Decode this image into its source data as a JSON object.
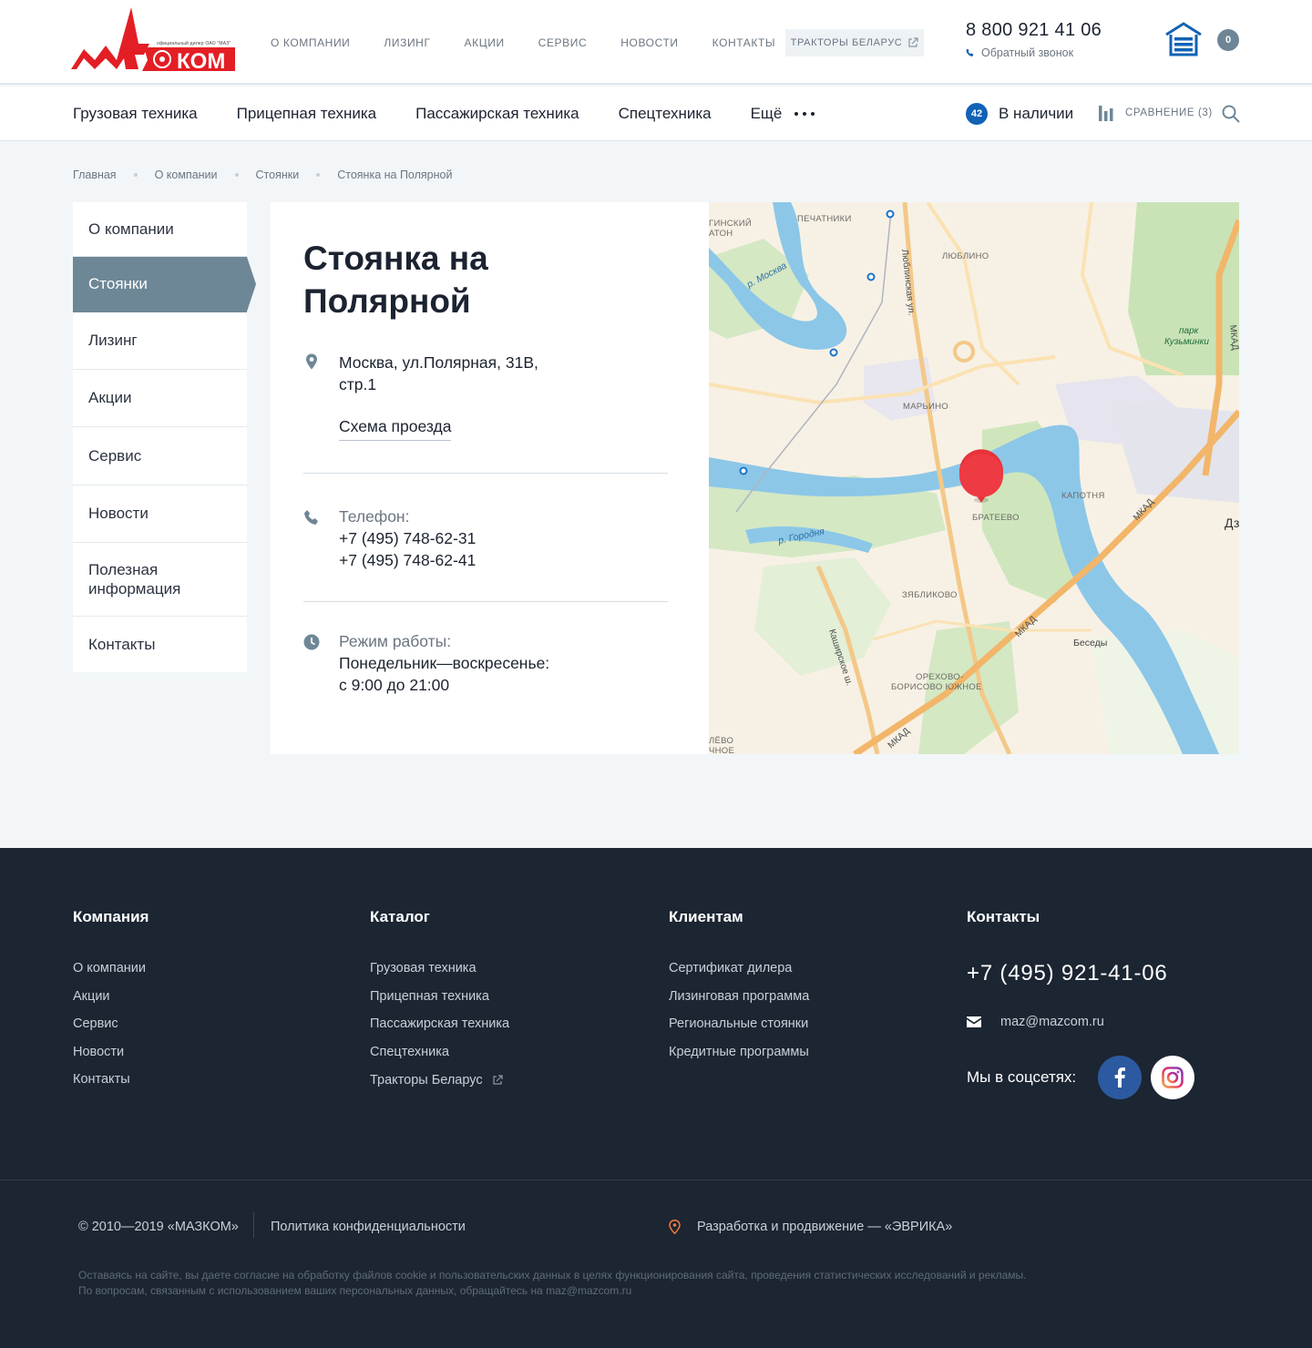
{
  "header": {
    "logo_dealer_text": "официальный дилер ОАО \"МАЗ\"",
    "logo_text": "МАЗКОМ",
    "top_nav": [
      "О компании",
      "Лизинг",
      "Акции",
      "Сервис",
      "Новости",
      "Контакты"
    ],
    "tractors_button": "Тракторы Беларус",
    "phone": "8 800 921 41 06",
    "callback": "Обратный звонок",
    "cart_count": "0"
  },
  "catalog_nav": {
    "items": [
      "Грузовая техника",
      "Прицепная техника",
      "Пассажирская техника",
      "Спецтехника"
    ],
    "more_label": "Ещё",
    "in_stock_count": "42",
    "in_stock_label": "В наличии",
    "compare_label": "Сравнение (3)"
  },
  "breadcrumb": [
    "Главная",
    "О компании",
    "Стоянки",
    "Стоянка на Полярной"
  ],
  "sidebar": {
    "items": [
      {
        "label": "О компании",
        "active": false
      },
      {
        "label": "Стоянки",
        "active": true
      },
      {
        "label": "Лизинг",
        "active": false
      },
      {
        "label": "Акции",
        "active": false
      },
      {
        "label": "Сервис",
        "active": false
      },
      {
        "label": "Новости",
        "active": false
      },
      {
        "label": "Полезная информация",
        "active": false
      },
      {
        "label": "Контакты",
        "active": false
      }
    ]
  },
  "location": {
    "title": "Стоянка на Полярной",
    "address_line1": "Москва, ул.Полярная, 31В,",
    "address_line2": "стр.1",
    "route_link": "Схема проезда",
    "phone_label": "Телефон:",
    "phone1": "+7 (495) 748-62-31",
    "phone2": "+7 (495) 748-62-41",
    "hours_label": "Режим работы:",
    "hours_days": "Понедельник—воскресенье:",
    "hours_time": "с 9:00 до 21:00"
  },
  "map": {
    "labels": {
      "pechatniki": "ПЕЧАТНИКИ",
      "lyublino": "ЛЮБЛИНО",
      "maryino": "МАРЬИНО",
      "kapotnya": "КАПОТНЯ",
      "brateevo": "БРАТЕЕВО",
      "zyablikovo": "ЗЯБЛИКОВО",
      "orekhovo": "ОРЕХОВО-",
      "borisovo": "БОРИСОВО ЮЖНОЕ",
      "besedy": "Беседы",
      "moskva_river": "р. Москва",
      "gorodnya": "р. Городня",
      "lyublinskaya": "Люблинская ул.",
      "kashirskoe": "Каширское ш.",
      "mkad1": "МКАД",
      "mkad2": "МКАД",
      "mkad3": "МКАД",
      "mkad4": "МКАД",
      "park1": "парк",
      "park2": "Кузьминки",
      "edge_top1": "ГИНСКИЙ",
      "edge_top2": "АТОН",
      "edge_bottom1": "ЛЁВО",
      "edge_bottom2": "ЧНОЕ",
      "edge_right": "Дз"
    }
  },
  "footer": {
    "company_title": "Компания",
    "company_links": [
      "О компании",
      "Акции",
      "Сервис",
      "Новости",
      "Контакты"
    ],
    "catalog_title": "Каталог",
    "catalog_links": [
      "Грузовая техника",
      "Прицепная техника",
      "Пассажирская техника",
      "Спецтехника"
    ],
    "catalog_ext_link": "Тракторы Беларус",
    "clients_title": "Клиентам",
    "clients_links": [
      "Сертификат дилера",
      "Лизинговая программа",
      "Региональные стоянки",
      "Кредитные программы"
    ],
    "contacts_title": "Контакты",
    "phone": "+7 (495) 921-41-06",
    "email": "maz@mazcom.ru",
    "social_label": "Мы в соцсетях:",
    "copyright": "© 2010—2019 «МАЗКОМ»",
    "policy": "Политика конфиденциальности",
    "developer": "Разработка и продвижение — «ЭВРИКА»",
    "note_line1": "Оставаясь на сайте, вы даете согласие на обработку файлов cookie и пользовательских данных в целях функционирования сайта, проведения статистических исследований и рекламы.",
    "note_line2": "По вопросам, связанным с использованием ваших персональных данных, обращайтесь на maz@mazcom.ru"
  },
  "colors": {
    "accent_blue": "#1162b5",
    "sidebar_active": "#6e8797",
    "footer_bg": "#1c2532",
    "logo_red": "#e31e24",
    "map_pin": "#e8323a"
  }
}
